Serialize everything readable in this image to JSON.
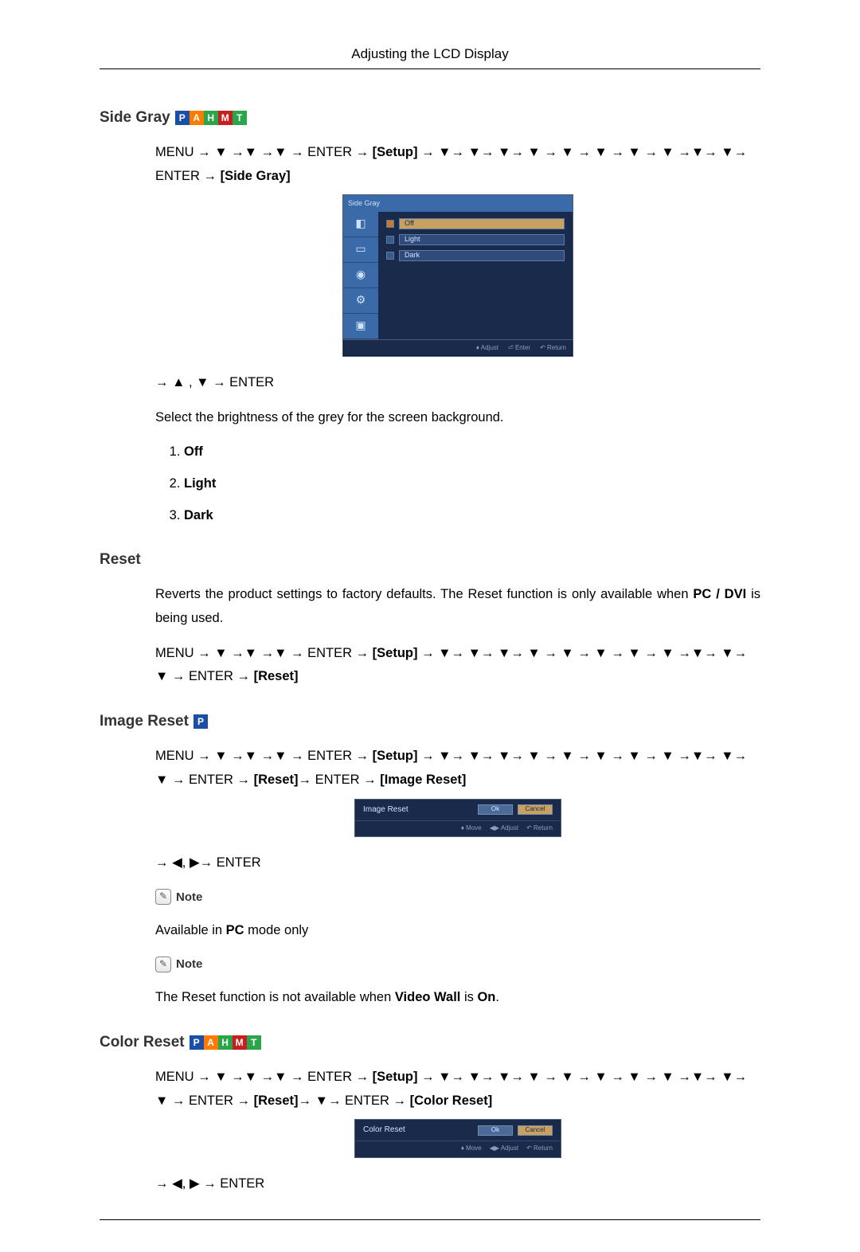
{
  "header": {
    "title": "Adjusting the LCD Display"
  },
  "badges": {
    "P": "P",
    "A": "A",
    "H": "H",
    "M": "M",
    "T": "T"
  },
  "side_gray": {
    "heading": "Side Gray",
    "path_a": "MENU → ▼ →▼ →▼ → ENTER → ",
    "setup_label": "[Setup]",
    "path_b": " → ▼→ ▼→ ▼→ ▼ → ▼ → ▼ → ▼ → ▼ →▼→ ▼→ ENTER → ",
    "target_label": "[Side Gray]",
    "osd": {
      "title": "Side Gray",
      "options": [
        {
          "label": "Off",
          "selected": true
        },
        {
          "label": "Light",
          "selected": false
        },
        {
          "label": "Dark",
          "selected": false
        }
      ],
      "footer": {
        "adjust": "♦ Adjust",
        "enter": "⏎ Enter",
        "return": "↶ Return"
      }
    },
    "post_nav": "→ ▲ , ▼ → ENTER",
    "description": "Select the brightness of the grey for the screen background.",
    "list": [
      "Off",
      "Light",
      "Dark"
    ]
  },
  "reset": {
    "heading": "Reset",
    "desc_a": "Reverts the product settings to factory defaults. The Reset function is only available when ",
    "desc_bold": "PC / DVI",
    "desc_b": " is being used.",
    "path_a": "MENU → ▼ →▼ →▼ → ENTER → ",
    "setup_label": "[Setup]",
    "path_b": " → ▼→ ▼→ ▼→ ▼ → ▼ → ▼ → ▼ → ▼ →▼→ ▼→ ▼ → ENTER → ",
    "target_label": "[Reset]"
  },
  "image_reset": {
    "heading": "Image Reset",
    "path_a": "MENU → ▼ →▼ →▼ → ENTER → ",
    "setup_label": "[Setup]",
    "path_b": " → ▼→ ▼→ ▼→ ▼ → ▼ → ▼ → ▼ → ▼ →▼→ ▼→ ▼ → ENTER → ",
    "reset_label": "[Reset]",
    "path_c": "→ ENTER → ",
    "target_label": "[Image Reset]",
    "dialog": {
      "title": "Image Reset",
      "ok": "Ok",
      "cancel": "Cancel",
      "move": "♦ Move",
      "adjust": "◀▶ Adjust",
      "return": "↶ Return"
    },
    "post_nav": "→ ◀, ▶→ ENTER",
    "note_label": "Note",
    "note1_a": "Available in ",
    "note1_bold": "PC",
    "note1_b": " mode only",
    "note2_a": "The Reset function is not available when ",
    "note2_bold": "Video Wall",
    "note2_b": " is ",
    "note2_bold2": "On",
    "note2_c": "."
  },
  "color_reset": {
    "heading": "Color Reset",
    "path_a": "MENU → ▼ →▼ →▼ → ENTER → ",
    "setup_label": "[Setup]",
    "path_b": " → ▼→ ▼→ ▼→ ▼ → ▼ → ▼ → ▼ → ▼ →▼→ ▼→ ▼ → ENTER → ",
    "reset_label": "[Reset]",
    "path_c": "→ ▼→ ENTER → ",
    "target_label": "[Color Reset]",
    "dialog": {
      "title": "Color Reset",
      "ok": "Ok",
      "cancel": "Cancel",
      "move": "♦ Move",
      "adjust": "◀▶ Adjust",
      "return": "↶ Return"
    },
    "post_nav": "→ ◀, ▶ → ENTER"
  }
}
